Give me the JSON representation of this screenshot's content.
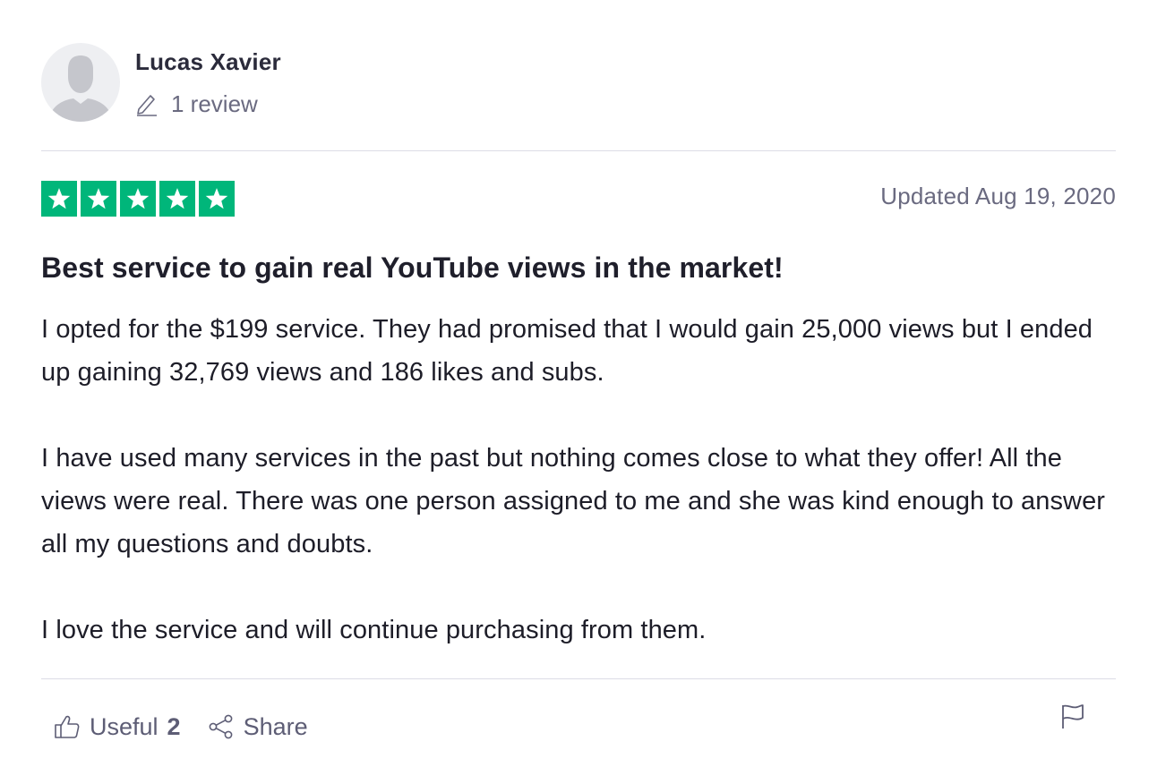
{
  "reviewer": {
    "name": "Lucas Xavier",
    "review_count": "1 review",
    "avatar_icon": "default-user-avatar"
  },
  "rating": {
    "stars": 5,
    "max_stars": 5,
    "color": "#00b67a",
    "date_label": "Updated Aug 19, 2020"
  },
  "review": {
    "title": "Best service to gain real YouTube views in the market!",
    "paragraphs": [
      "I opted for the $199 service. They had promised that I would gain 25,000 views but I ended up gaining 32,769 views and 186 likes and subs.",
      "I have used many services in the past but nothing comes close to what they offer! All the views were real. There was one person assigned to me and she was kind enough to answer all my questions and doubts.",
      "I love the service and will continue purchasing from them."
    ]
  },
  "actions": {
    "useful_label": "Useful",
    "useful_count": "2",
    "share_label": "Share",
    "icons": [
      "thumbs-up-icon",
      "share-icon",
      "flag-icon"
    ]
  }
}
